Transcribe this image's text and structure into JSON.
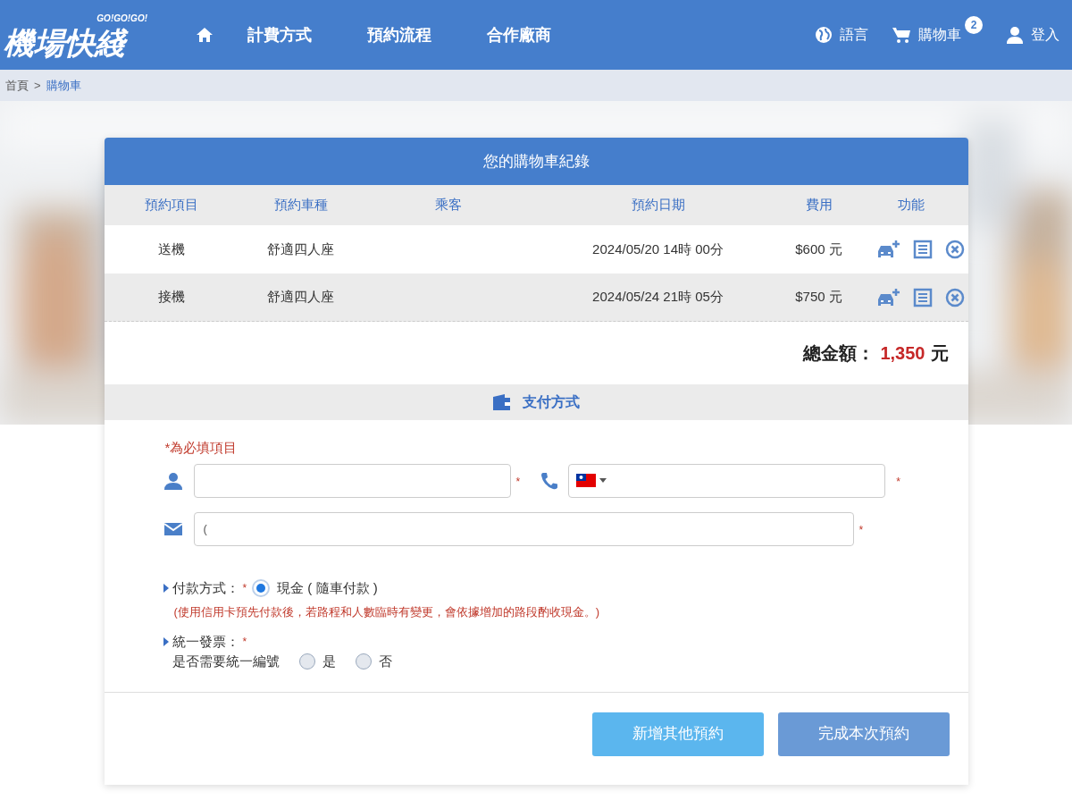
{
  "header": {
    "logo": "機場快綫",
    "logo_tagline": "GO!GO!GO!",
    "nav": [
      {
        "label": "計費方式"
      },
      {
        "label": "預約流程"
      },
      {
        "label": "合作廠商"
      }
    ],
    "language": "語言",
    "cart": "購物車",
    "cart_count": "2",
    "login": "登入"
  },
  "breadcrumb": [
    {
      "label": "首頁",
      "selected": false
    },
    {
      "label": "購物車",
      "selected": true
    }
  ],
  "breadcrumb_separator": ">",
  "cart_panel": {
    "title": "您的購物車紀錄",
    "columns": [
      "預約項目",
      "預約車種",
      "乘客",
      "預約日期",
      "費用",
      "功能"
    ],
    "rows": [
      {
        "item": "送機",
        "car": "舒適四人座",
        "date": "2024/05/20 14時 00分",
        "fee": "$600 元"
      },
      {
        "item": "接機",
        "car": "舒適四人座",
        "date": "2024/05/24 21時 05分",
        "fee": "$750 元"
      }
    ],
    "total_label": "總金額：",
    "total_value": "1,350",
    "total_unit": "元"
  },
  "payment": {
    "title": "支付方式",
    "required_note": "*為必填項目",
    "required_marks": [
      "*",
      "*",
      "*",
      "*",
      "*"
    ],
    "email_value": "(",
    "pay_label": "付款方式：",
    "pay_options": [
      {
        "label": "現金 ( 隨車付款 )",
        "selected": true
      }
    ],
    "pay_note": "(使用信用卡預先付款後，若路程和人數臨時有變更，會依據增加的路段酌收現金。)",
    "invoice_label": "統一發票：",
    "invoice_question": "是否需要統一編號",
    "invoice_options": [
      {
        "label": "是",
        "selected": false
      },
      {
        "label": "否",
        "selected": false
      }
    ]
  },
  "buttons": [
    {
      "label": "新增其他預約",
      "kind": "secondary"
    },
    {
      "label": "完成本次預約",
      "kind": "primary"
    }
  ]
}
